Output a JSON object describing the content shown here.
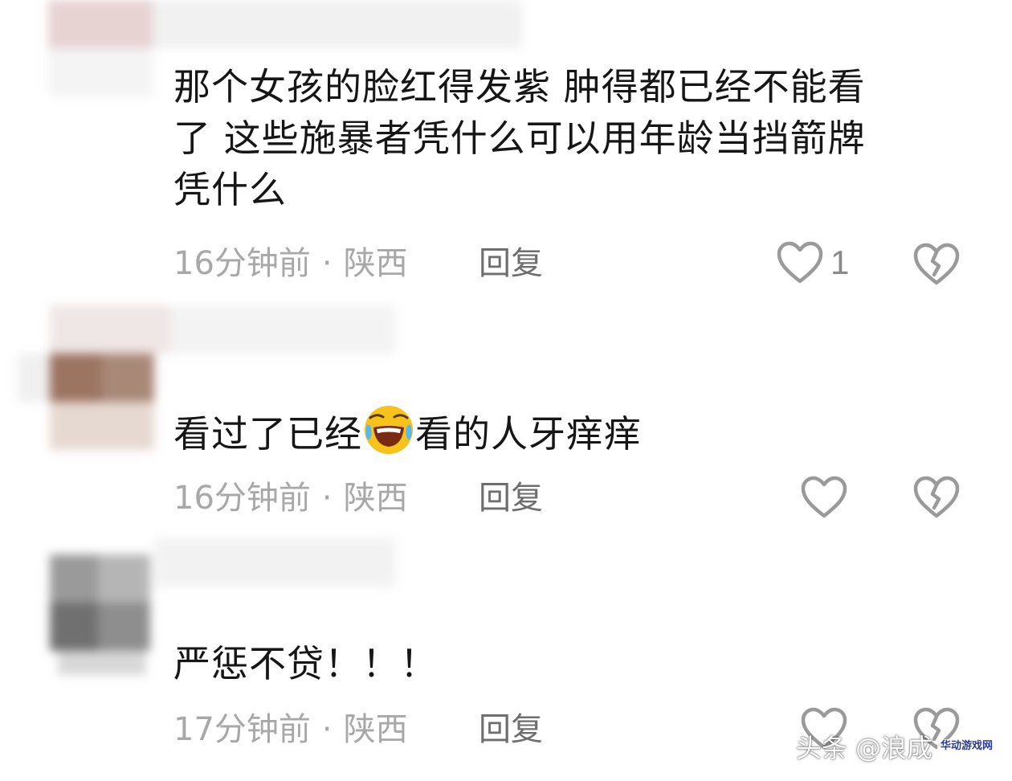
{
  "comments": [
    {
      "text_lines": [
        "那个女孩的脸红得发紫 肿得都已经不能看",
        "了 这些施暴者凭什么可以用年龄当挡箭牌",
        "凭什么"
      ],
      "time": "16分钟前",
      "dot": "·",
      "location": "陕西",
      "reply": "回复",
      "like_count": "1"
    },
    {
      "text_before": "看过了已经",
      "emoji": "laughing-crying-emoji",
      "text_after": "看的人牙痒痒",
      "time": "16分钟前",
      "dot": "·",
      "location": "陕西",
      "reply": "回复",
      "like_count": ""
    },
    {
      "text": "严惩不贷！！！",
      "time": "17分钟前",
      "dot": "·",
      "location": "陕西",
      "reply": "回复",
      "like_count": ""
    }
  ],
  "watermark": {
    "text": "头条 @浪成",
    "badge": "华动游戏网"
  },
  "colors": {
    "text": "#161616",
    "meta": "#a8a8a8",
    "icon": "#9a9a9a"
  },
  "icons": [
    "heart-icon",
    "broken-heart-icon"
  ]
}
